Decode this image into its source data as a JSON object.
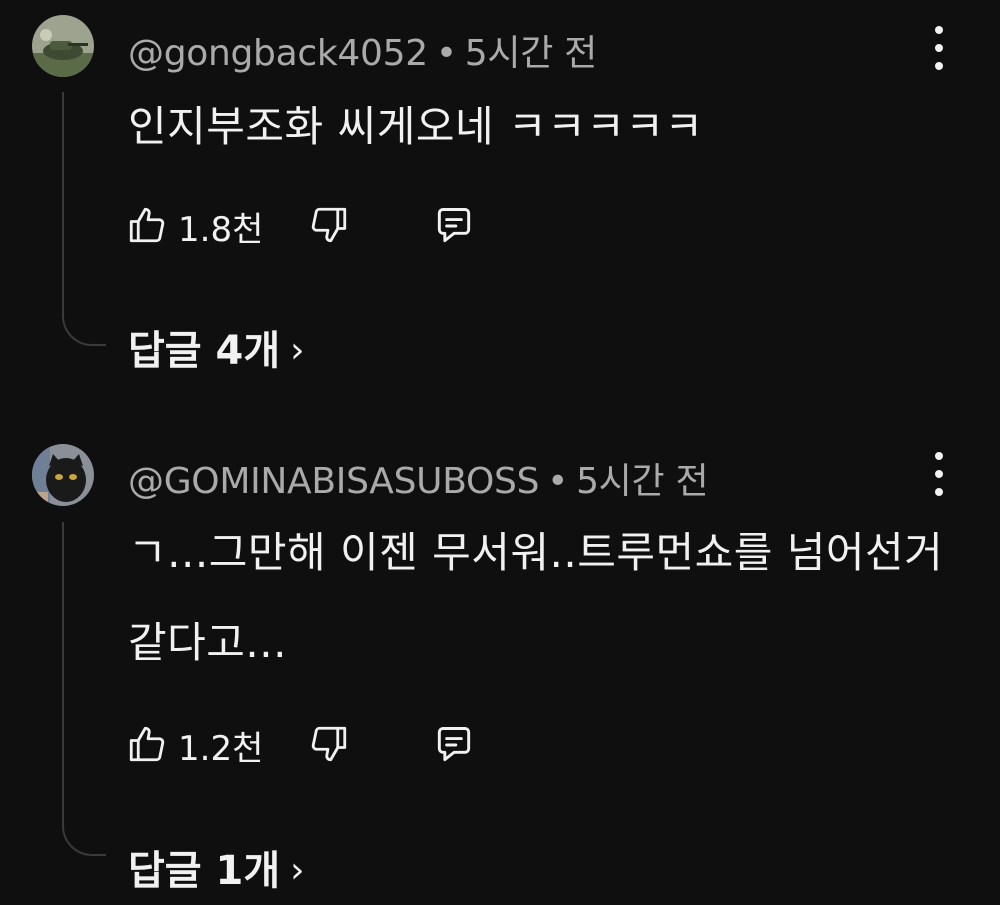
{
  "comments": [
    {
      "username": "@gongback4052",
      "separator": "•",
      "time": "5시간 전",
      "text": "인지부조화 씨게오네 ㅋㅋㅋㅋㅋ",
      "likes": "1.8천",
      "replies_label": "답글 4개",
      "replies_chevron": "›"
    },
    {
      "username": "@GOMINABISASUBOSS",
      "separator": "•",
      "time": "5시간 전",
      "text": "ㄱ...그만해 이젠 무서워..트루먼쇼를 넘어선거같다고...",
      "likes": "1.2천",
      "replies_label": "답글 1개",
      "replies_chevron": "›"
    }
  ],
  "icons": {
    "like": "thumbs-up-icon",
    "dislike": "thumbs-down-icon",
    "reply": "reply-comment-icon",
    "more": "more-vertical-icon"
  },
  "colors": {
    "background": "#0f0f0f",
    "meta_text": "#aaaaaa",
    "primary_text": "#f1f1f1",
    "thread_line": "#3a3a3a"
  }
}
